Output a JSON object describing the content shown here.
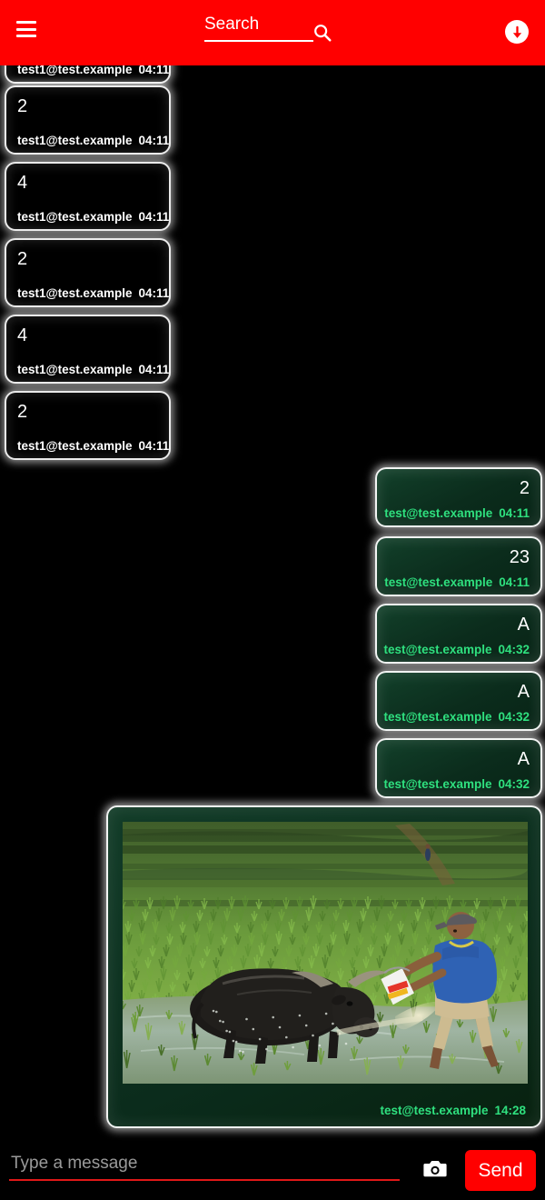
{
  "header": {
    "menu_icon": "hamburger-menu-icon",
    "search_value": "Search",
    "search_placeholder": "Search",
    "search_icon": "search-icon",
    "scroll_icon": "arrow-down-circle-icon",
    "background_color": "#ff0000"
  },
  "messages": [
    {
      "id": "m1",
      "side": "left",
      "text": "",
      "sender": "test1@test.example",
      "time": "04:11",
      "clipped": true
    },
    {
      "id": "m2",
      "side": "left",
      "text": "2",
      "sender": "test1@test.example",
      "time": "04:11"
    },
    {
      "id": "m3",
      "side": "left",
      "text": "4",
      "sender": "test1@test.example",
      "time": "04:11"
    },
    {
      "id": "m4",
      "side": "left",
      "text": "2",
      "sender": "test1@test.example",
      "time": "04:11"
    },
    {
      "id": "m5",
      "side": "left",
      "text": "4",
      "sender": "test1@test.example",
      "time": "04:11"
    },
    {
      "id": "m6",
      "side": "left",
      "text": "2",
      "sender": "test1@test.example",
      "time": "04:11"
    },
    {
      "id": "m7",
      "side": "right",
      "text": "2",
      "sender": "test@test.example",
      "time": "04:11"
    },
    {
      "id": "m8",
      "side": "right",
      "text": "23",
      "sender": "test@test.example",
      "time": "04:11"
    },
    {
      "id": "m9",
      "side": "right",
      "text": "A",
      "sender": "test@test.example",
      "time": "04:32"
    },
    {
      "id": "m10",
      "side": "right",
      "text": "A",
      "sender": "test@test.example",
      "time": "04:32"
    },
    {
      "id": "m11",
      "side": "right",
      "text": "A",
      "sender": "test@test.example",
      "time": "04:32"
    },
    {
      "id": "m12",
      "side": "right",
      "type": "image",
      "alt": "man splashing water on a water buffalo in a green rice paddy field",
      "sender": "test@test.example",
      "time": "14:28"
    }
  ],
  "composer": {
    "placeholder": "Type a message",
    "value": "",
    "camera_icon": "camera-icon",
    "send_label": "Send",
    "send_color": "#ff0000",
    "underline_color": "#e01818"
  },
  "colors": {
    "background": "#000000",
    "accent": "#ff0000",
    "outgoing_bubble": "#0b2c1c",
    "outgoing_meta_text": "#2fe07f",
    "incoming_bubble": "#000000",
    "incoming_meta_text": "#ffffff"
  }
}
